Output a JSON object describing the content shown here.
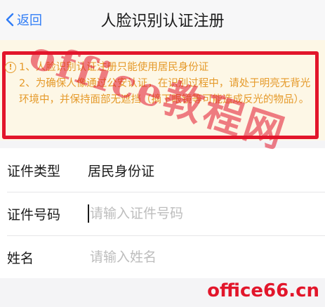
{
  "navbar": {
    "back_label": "返回",
    "title": "人脸识别认证注册"
  },
  "notice": {
    "line1": "1、人脸识别认证注册只能使用居民身份证",
    "line2": "2、为确保人像通过公安认证，在识别过程中，请处于明亮无背光环境中，并保持面部无遮挡（摘下眼镜等可能造成反光的物品）。",
    "accent_color": "#e59a2a",
    "frame_color": "#e2162b"
  },
  "form": {
    "id_type": {
      "label": "证件类型",
      "value": "居民身份证"
    },
    "id_number": {
      "label": "证件号码",
      "placeholder": "请输入证件号码"
    },
    "name": {
      "label": "姓名",
      "placeholder": "请输入姓名"
    }
  },
  "watermarks": {
    "overlay": "office教程网",
    "site": "office66.cn"
  },
  "colors": {
    "link": "#2f7cf6",
    "background": "#f4f4f6"
  }
}
